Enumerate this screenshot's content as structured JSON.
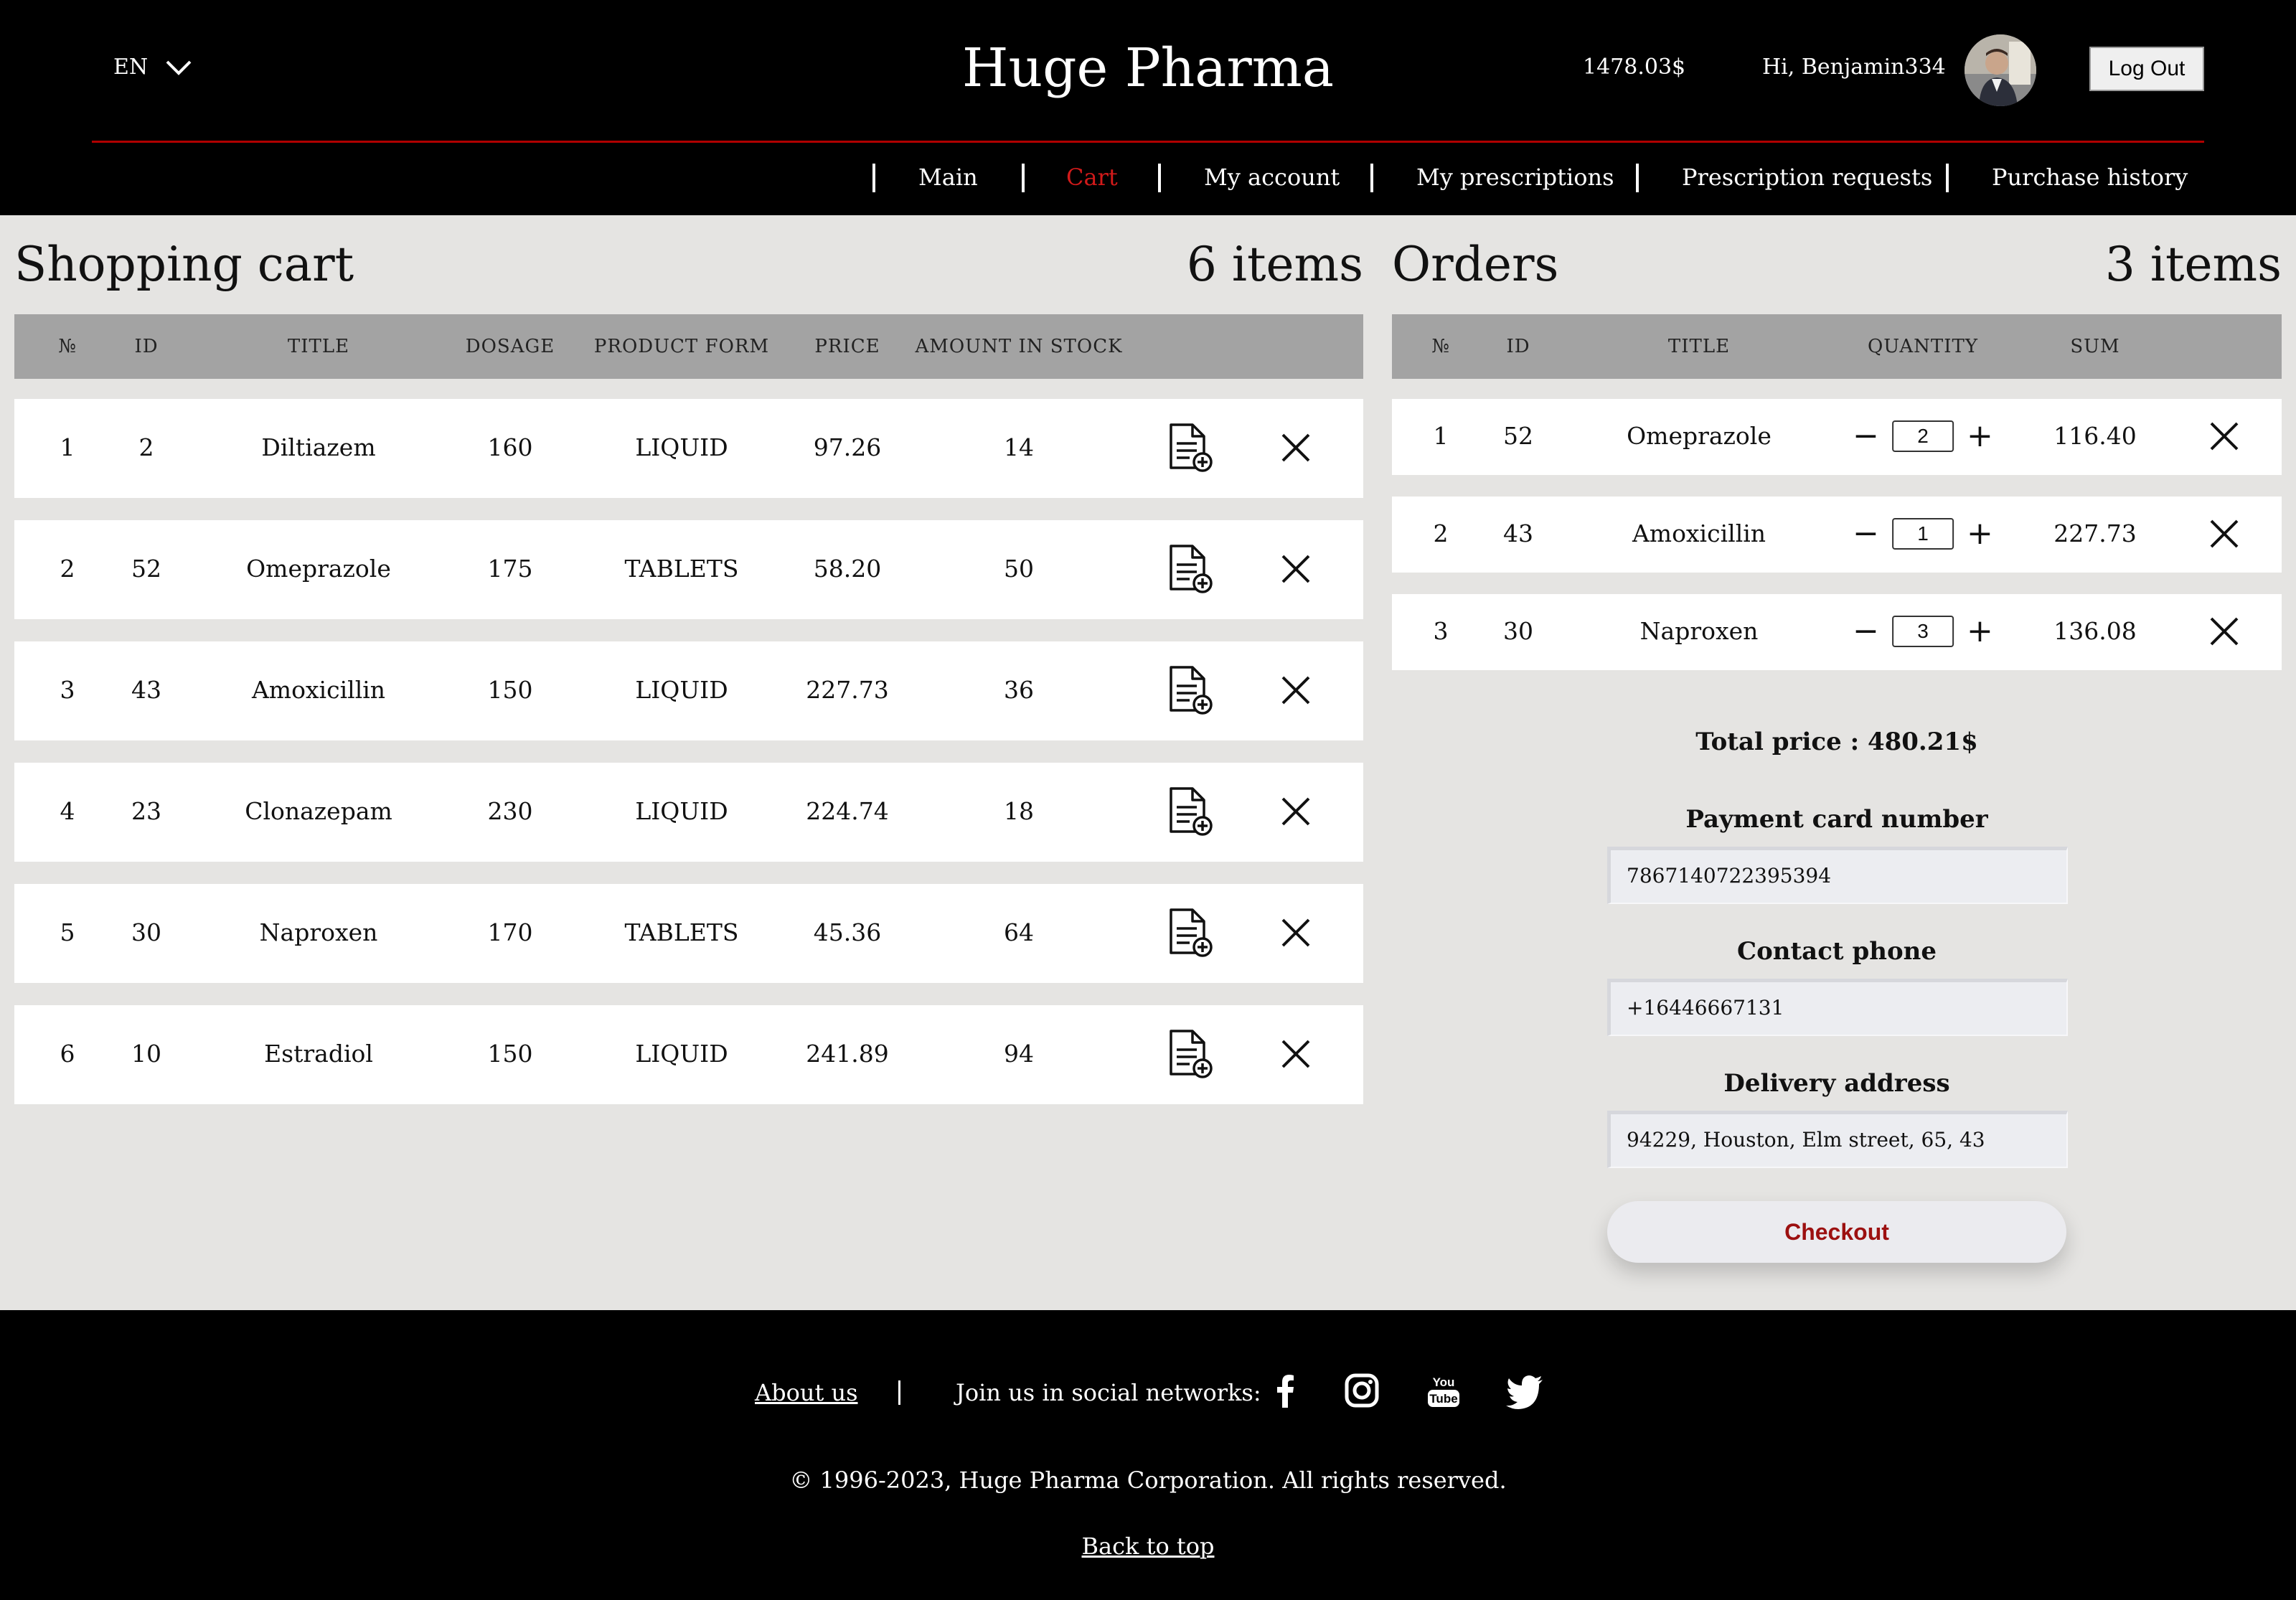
{
  "header": {
    "language": "EN",
    "brand": "Huge Pharma",
    "balance": "1478.03$",
    "greeting": "Hi, Benjamin334",
    "logout_label": "Log Out"
  },
  "nav": {
    "items": [
      {
        "label": "Main",
        "active": false
      },
      {
        "label": "Cart",
        "active": true
      },
      {
        "label": "My account",
        "active": false
      },
      {
        "label": "My prescriptions",
        "active": false
      },
      {
        "label": "Prescription requests",
        "active": false
      },
      {
        "label": "Purchase history",
        "active": false
      }
    ]
  },
  "cart": {
    "title": "Shopping cart",
    "count": "6 items",
    "columns": [
      "№",
      "ID",
      "TITLE",
      "DOSAGE",
      "PRODUCT FORM",
      "PRICE",
      "AMOUNT IN STOCK"
    ],
    "rows": [
      {
        "n": "1",
        "id": "2",
        "title": "Diltiazem",
        "dosage": "160",
        "form": "LIQUID",
        "price": "97.26",
        "stock": "14"
      },
      {
        "n": "2",
        "id": "52",
        "title": "Omeprazole",
        "dosage": "175",
        "form": "TABLETS",
        "price": "58.20",
        "stock": "50"
      },
      {
        "n": "3",
        "id": "43",
        "title": "Amoxicillin",
        "dosage": "150",
        "form": "LIQUID",
        "price": "227.73",
        "stock": "36"
      },
      {
        "n": "4",
        "id": "23",
        "title": "Clonazepam",
        "dosage": "230",
        "form": "LIQUID",
        "price": "224.74",
        "stock": "18"
      },
      {
        "n": "5",
        "id": "30",
        "title": "Naproxen",
        "dosage": "170",
        "form": "TABLETS",
        "price": "45.36",
        "stock": "64"
      },
      {
        "n": "6",
        "id": "10",
        "title": "Estradiol",
        "dosage": "150",
        "form": "LIQUID",
        "price": "241.89",
        "stock": "94"
      }
    ]
  },
  "orders": {
    "title": "Orders",
    "count": "3 items",
    "columns": [
      "№",
      "ID",
      "TITLE",
      "QUANTITY",
      "SUM"
    ],
    "rows": [
      {
        "n": "1",
        "id": "52",
        "title": "Omeprazole",
        "quantity": "2",
        "sum": "116.40"
      },
      {
        "n": "2",
        "id": "43",
        "title": "Amoxicillin",
        "quantity": "1",
        "sum": "227.73"
      },
      {
        "n": "3",
        "id": "30",
        "title": "Naproxen",
        "quantity": "3",
        "sum": "136.08"
      }
    ],
    "total": "Total price : 480.21$",
    "card_label": "Payment card number",
    "card_value": "7867140722395394",
    "phone_label": "Contact phone",
    "phone_value": "+16446667131",
    "address_label": "Delivery address",
    "address_value": "94229, Houston, Elm street, 65, 43",
    "checkout_label": "Checkout"
  },
  "footer": {
    "about": "About us",
    "join": "Join us in social networks:",
    "social_icons": [
      "facebook-icon",
      "instagram-icon",
      "youtube-icon",
      "twitter-icon"
    ],
    "copyright": "© 1996-2023, Huge Pharma Corporation. All rights reserved.",
    "back_to_top": "Back to top"
  },
  "colors": {
    "accent_red": "#d21a1a",
    "header_bg": "#000000",
    "main_bg": "#e5e4e2",
    "table_header_bg": "#a3a3a3"
  }
}
